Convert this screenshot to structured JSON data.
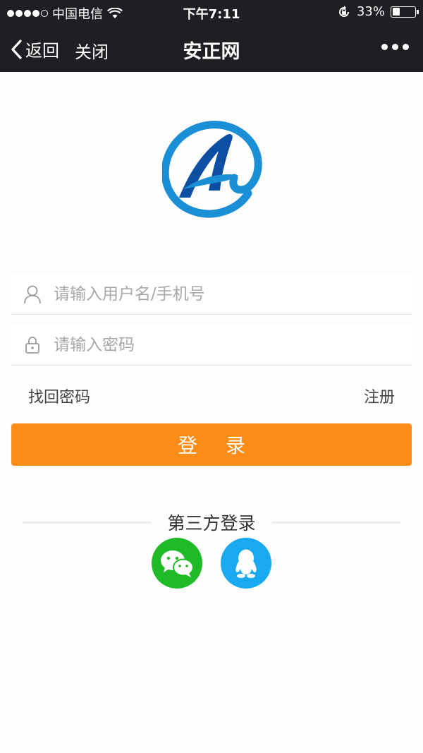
{
  "status_bar": {
    "carrier": "中国电信",
    "time": "下午7:11",
    "battery": "33%",
    "battery_level": 0.33
  },
  "nav": {
    "back_label": "返回",
    "close_label": "关闭",
    "title": "安正网"
  },
  "form": {
    "username_placeholder": "请输入用户名/手机号",
    "password_placeholder": "请输入密码",
    "forgot_label": "找回密码",
    "register_label": "注册",
    "login_label": "登录"
  },
  "third_party": {
    "label": "第三方登录",
    "providers": [
      "wechat",
      "qq"
    ]
  },
  "colors": {
    "bar_bg": "#1f1f23",
    "accent": "#fb8c17",
    "wechat": "#1fbb26",
    "qq": "#18a9f0",
    "logo_blue": "#1b8fd6",
    "logo_dark_blue": "#0b4ea2"
  }
}
